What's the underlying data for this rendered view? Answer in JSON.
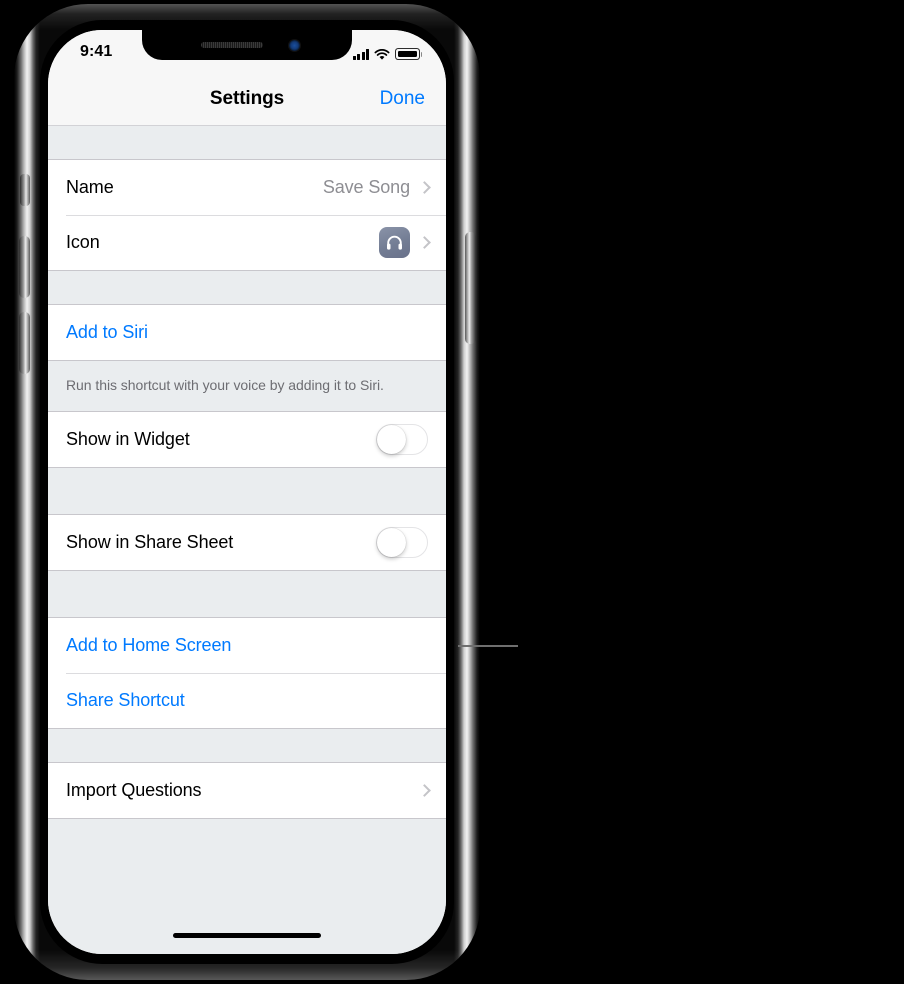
{
  "status_bar": {
    "time": "9:41",
    "signal_icon": "cellular-signal-icon",
    "wifi_icon": "wifi-icon",
    "battery_icon": "battery-icon"
  },
  "nav_bar": {
    "title": "Settings",
    "done_label": "Done"
  },
  "accent_color": "#007aff",
  "sections": [
    {
      "rows": [
        {
          "label": "Name",
          "value": "Save Song",
          "accessory": "chevron",
          "type": "value-row"
        },
        {
          "label": "Icon",
          "value": "",
          "accessory": "chevron",
          "type": "icon-row",
          "icon": "headphones-icon",
          "icon_color": "#737d94"
        }
      ]
    },
    {
      "rows": [
        {
          "label": "Add to Siri",
          "type": "action-row",
          "style": "blue"
        }
      ],
      "footer": "Run this shortcut with your voice by adding it to Siri."
    },
    {
      "rows": [
        {
          "label": "Show in Widget",
          "type": "toggle-row",
          "value": "off"
        }
      ]
    },
    {
      "rows": [
        {
          "label": "Show in Share Sheet",
          "type": "toggle-row",
          "value": "off"
        }
      ]
    },
    {
      "rows": [
        {
          "label": "Add to Home Screen",
          "type": "action-row",
          "style": "blue"
        },
        {
          "label": "Share Shortcut",
          "type": "action-row",
          "style": "blue"
        }
      ]
    },
    {
      "rows": [
        {
          "label": "Import Questions",
          "accessory": "chevron",
          "type": "value-row"
        }
      ]
    }
  ],
  "device": {
    "home_indicator": "home-indicator",
    "notch": "notch",
    "buttons": [
      "mute-switch",
      "volume-up-button",
      "volume-down-button",
      "power-button"
    ]
  },
  "annotation": {
    "callout_line": "callout-leader-line"
  }
}
